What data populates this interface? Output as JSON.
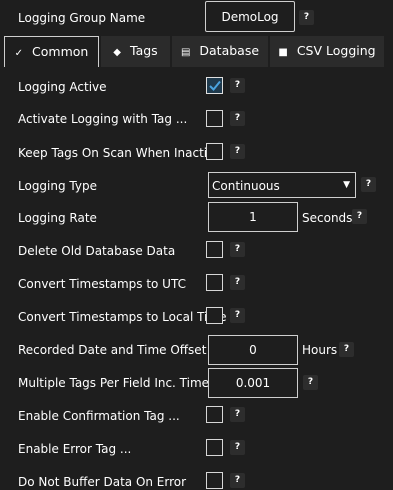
{
  "header": {
    "group_name_label": "Logging Group Name",
    "group_name_value": "DemoLog",
    "help": "?"
  },
  "tabs": [
    {
      "label": "Common",
      "icon": "list-check-icon",
      "glyph": "✓",
      "active": true
    },
    {
      "label": "Tags",
      "icon": "tag-icon",
      "glyph": "◆",
      "active": false
    },
    {
      "label": "Database",
      "icon": "database-icon",
      "glyph": "▤",
      "active": false
    },
    {
      "label": "CSV Logging",
      "icon": "csv-file-icon",
      "glyph": "■",
      "active": false
    }
  ],
  "settings": {
    "logging_active": {
      "label": "Logging Active",
      "checked": true
    },
    "activate_logging_with_tag": {
      "label": "Activate Logging with Tag ...",
      "checked": false
    },
    "keep_tags_on_scan": {
      "label": "Keep Tags On Scan When Inactive",
      "checked": false
    },
    "logging_type": {
      "label": "Logging Type",
      "value": "Continuous"
    },
    "logging_rate": {
      "label": "Logging Rate",
      "value": "1",
      "unit": "Seconds"
    },
    "delete_old_data": {
      "label": "Delete Old Database Data",
      "checked": false
    },
    "convert_utc": {
      "label": "Convert Timestamps to UTC",
      "checked": false
    },
    "convert_local": {
      "label": "Convert Timestamps to Local Time",
      "checked": false
    },
    "date_time_offset": {
      "label": "Recorded Date and Time Offset",
      "value": "0",
      "unit": "Hours"
    },
    "multiple_tags_per_field": {
      "label": "Multiple Tags Per Field Inc. Time",
      "value": "0.001"
    },
    "enable_confirmation_tag": {
      "label": "Enable Confirmation Tag ...",
      "checked": false
    },
    "enable_error_tag": {
      "label": "Enable Error Tag ...",
      "checked": false
    },
    "do_not_buffer": {
      "label": "Do Not Buffer Data On Error",
      "checked": false
    }
  },
  "help_text": "?",
  "colors": {
    "background": "#1e1e1e",
    "checkbox_accent": "#4aa3df",
    "field_border": "#cfcfcf"
  }
}
